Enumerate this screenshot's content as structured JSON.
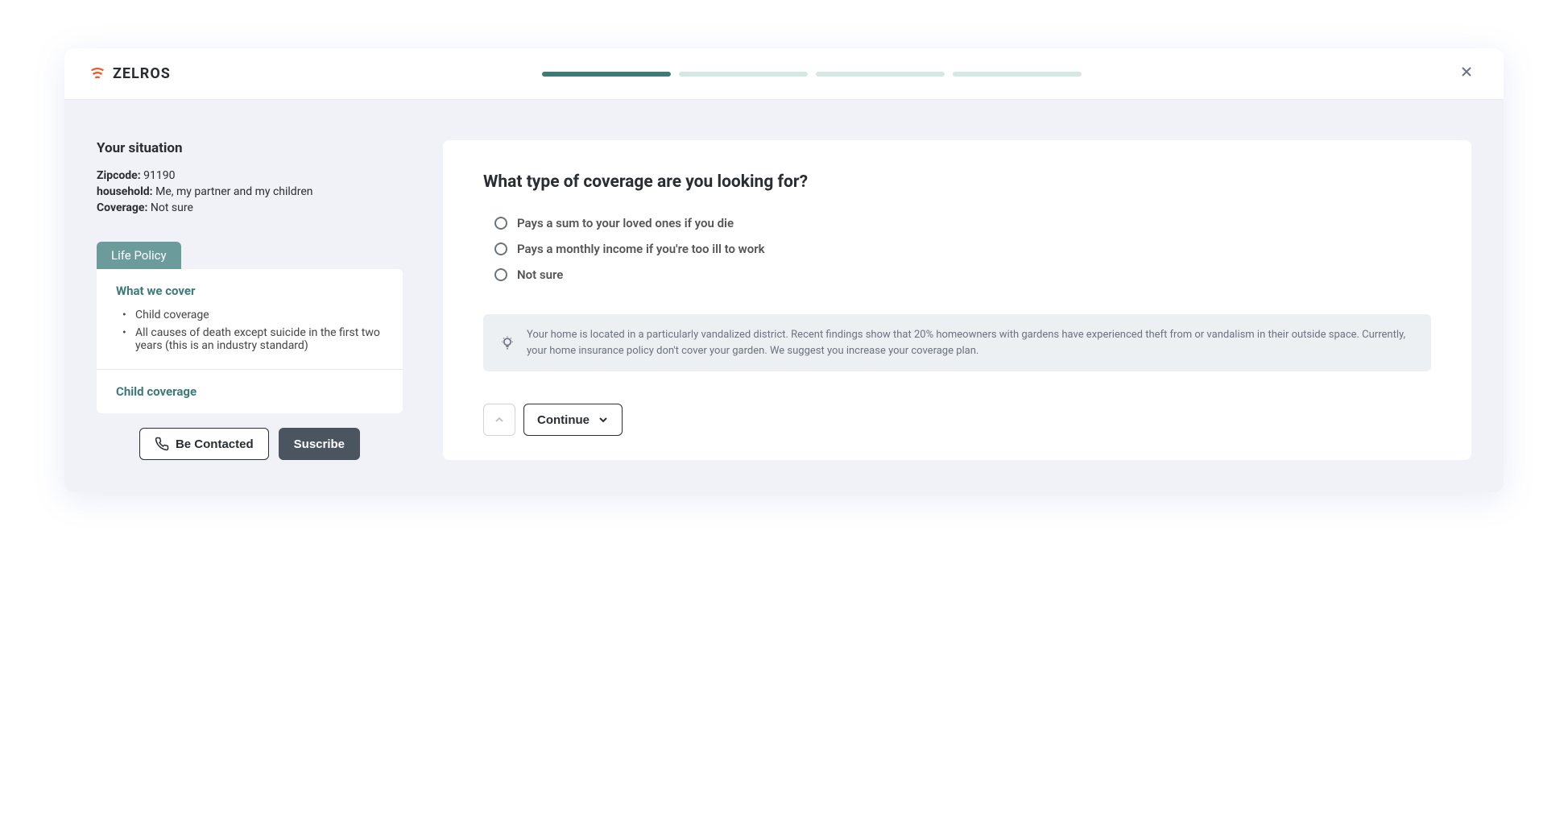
{
  "brand": "ZELROS",
  "progress": {
    "total": 4,
    "active": 1
  },
  "sidebar": {
    "title": "Your situation",
    "info": [
      {
        "label": "Zipcode:",
        "value": "91190"
      },
      {
        "label": "household:",
        "value": "Me, my partner and my children"
      },
      {
        "label": "Coverage:",
        "value": "Not sure"
      }
    ],
    "policy_tab": "Life Policy",
    "sections": [
      {
        "heading": "What we cover",
        "items": [
          "Child coverage",
          "All causes of death except suicide in the first two years (this is an industry standard)"
        ]
      },
      {
        "heading": "Child coverage",
        "items": []
      }
    ],
    "actions": {
      "contact": "Be Contacted",
      "subscribe": "Suscribe"
    }
  },
  "main": {
    "question": "What type of coverage are you looking for?",
    "options": [
      "Pays a sum to your loved ones if you die",
      "Pays a monthly income if you're too ill to work",
      "Not sure"
    ],
    "tip": "Your home is located in a particularly vandalized district. Recent findings show that 20% homeowners with gardens have experienced theft from or vandalism in their outside space. Currently, your home insurance policy don't cover your garden. We suggest you increase your coverage plan.",
    "continue": "Continue"
  }
}
